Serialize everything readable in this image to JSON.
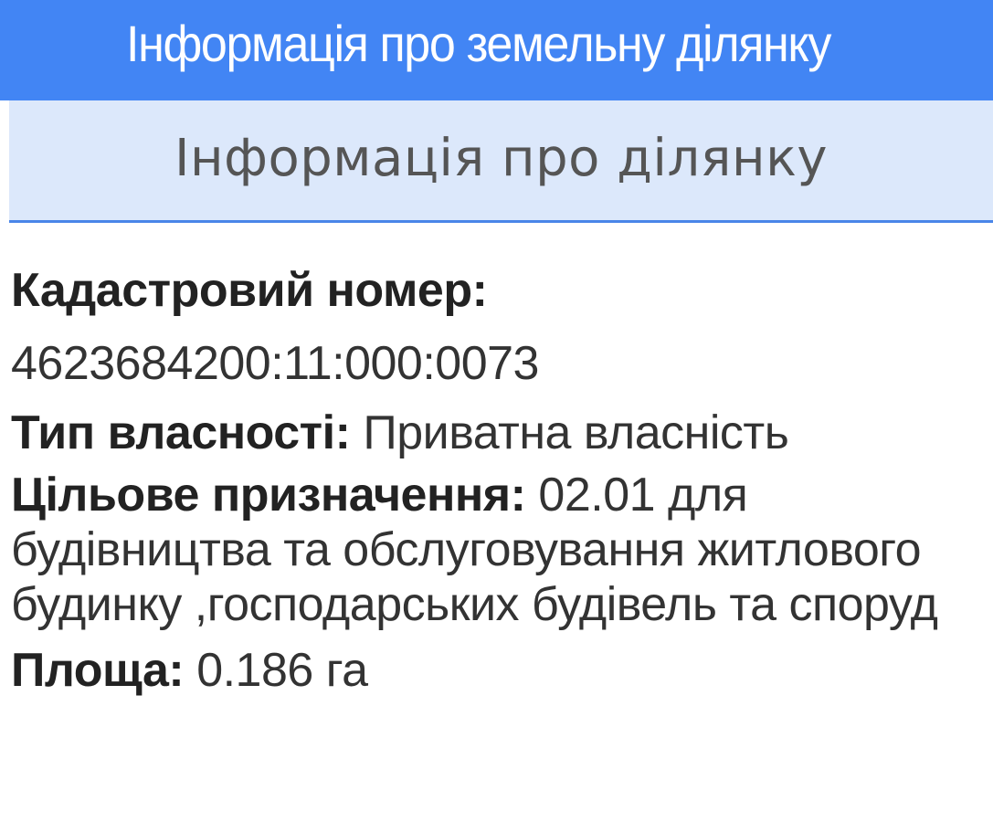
{
  "header": {
    "title": "Інформація про земельну ділянку"
  },
  "section": {
    "tab_label": "Інформація про ділянку"
  },
  "parcel": {
    "cadastral_label": "Кадастровий номер:",
    "cadastral_value": "4623684200:11:000:0073",
    "ownership_label": "Тип власності:",
    "ownership_value": "Приватна власність",
    "purpose_label": "Цільове призначення:",
    "purpose_value": "02.01 для будівництва та обслуговування житлового будинку ,господарських будівель та споруд",
    "area_label": "Площа:",
    "area_value": "0.186 га"
  },
  "colors": {
    "header_bg": "#4285f4",
    "section_bg": "#dce8fb",
    "section_border": "#4a86e8"
  }
}
